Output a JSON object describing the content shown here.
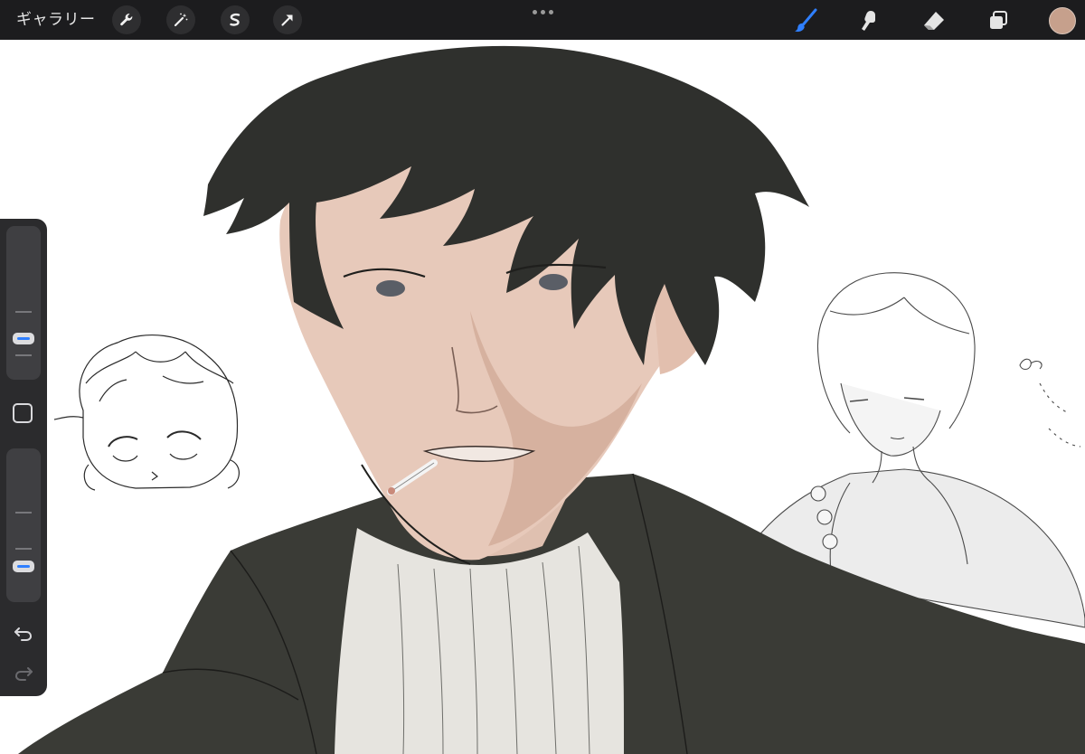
{
  "toolbar": {
    "gallery_label": "ギャラリー",
    "left_tools": [
      "wrench-icon",
      "magic-wand-icon",
      "selection-icon",
      "transform-arrow-icon"
    ],
    "right_tools": [
      "brush-icon",
      "smudge-icon",
      "eraser-icon",
      "layers-icon"
    ],
    "active_tool": "brush",
    "active_tool_color": "#2f7fff",
    "current_color": "#c6a08c"
  },
  "sidebar": {
    "brush_size_level": 0.3,
    "opacity_level": 0.25,
    "modifier": "square-modifier",
    "undo": "undo-icon",
    "redo": "redo-icon"
  },
  "canvas": {
    "background": "#ffffff",
    "main_figure_colors": {
      "hair": "#2f302d",
      "skin": "#e7c9ba",
      "coat": "#3a3b36",
      "shirt": "#e6e4df"
    }
  }
}
